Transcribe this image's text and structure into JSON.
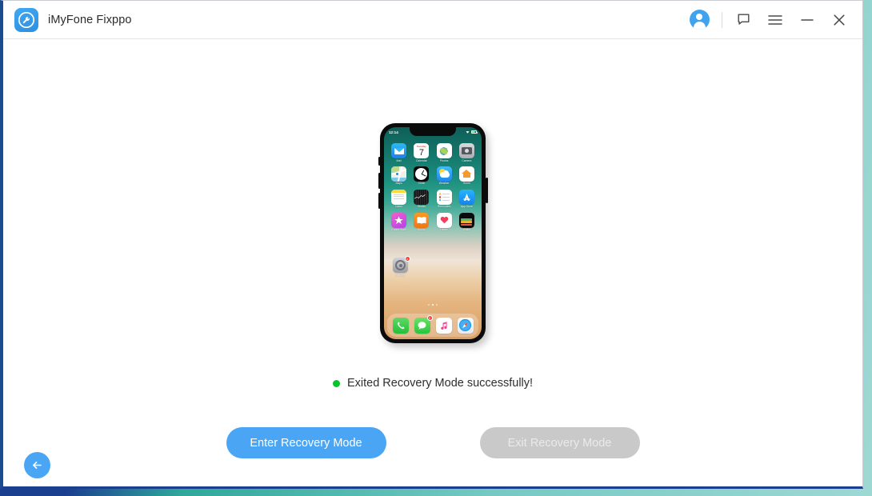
{
  "window": {
    "app_title": "iMyFone Fixppo",
    "logo_icon": "wrench-in-circle-logo",
    "accent_color": "#4aa5f5",
    "border_color": "#1b4b8f"
  },
  "titlebar": {
    "account_icon": "account-avatar-icon",
    "feedback_icon": "chat-bubble-icon",
    "menu_icon": "hamburger-menu-icon",
    "minimize_icon": "minimize-icon",
    "close_icon": "close-icon"
  },
  "phone": {
    "status_time": "12:14",
    "wifi_icon": "wifi-icon",
    "battery_icon": "battery-icon",
    "apps": [
      {
        "label": "Mail",
        "icon": "mail-icon"
      },
      {
        "label": "Calendar",
        "icon": "calendar-icon",
        "weekday": "Tuesday",
        "day": "7"
      },
      {
        "label": "Photos",
        "icon": "photos-icon"
      },
      {
        "label": "Camera",
        "icon": "camera-icon"
      },
      {
        "label": "Maps",
        "icon": "maps-icon"
      },
      {
        "label": "Clock",
        "icon": "clock-icon"
      },
      {
        "label": "Weather",
        "icon": "weather-icon"
      },
      {
        "label": "Home",
        "icon": "home-icon"
      },
      {
        "label": "Notes",
        "icon": "notes-icon"
      },
      {
        "label": "Stocks",
        "icon": "stocks-icon"
      },
      {
        "label": "Reminders",
        "icon": "reminders-icon"
      },
      {
        "label": "App Store",
        "icon": "app-store-icon"
      },
      {
        "label": "iTunes Store",
        "icon": "itunes-store-icon"
      },
      {
        "label": "Books",
        "icon": "books-icon"
      },
      {
        "label": "Health",
        "icon": "health-icon"
      },
      {
        "label": "Wallet",
        "icon": "wallet-icon"
      }
    ],
    "settings_app": {
      "label": "Settings",
      "icon": "settings-icon",
      "badge": "1"
    },
    "page_dots": 3,
    "active_page": 2,
    "dock": [
      {
        "label": "Phone",
        "icon": "phone-icon"
      },
      {
        "label": "Messages",
        "icon": "messages-icon",
        "badge": "2"
      },
      {
        "label": "Music",
        "icon": "music-icon"
      },
      {
        "label": "Safari",
        "icon": "safari-icon"
      }
    ]
  },
  "status": {
    "message": "Exited Recovery Mode successfully!",
    "dot_color": "#08c32c"
  },
  "actions": {
    "enter_label": "Enter Recovery Mode",
    "exit_label": "Exit Recovery Mode"
  },
  "footer": {
    "back_icon": "arrow-left-icon"
  }
}
